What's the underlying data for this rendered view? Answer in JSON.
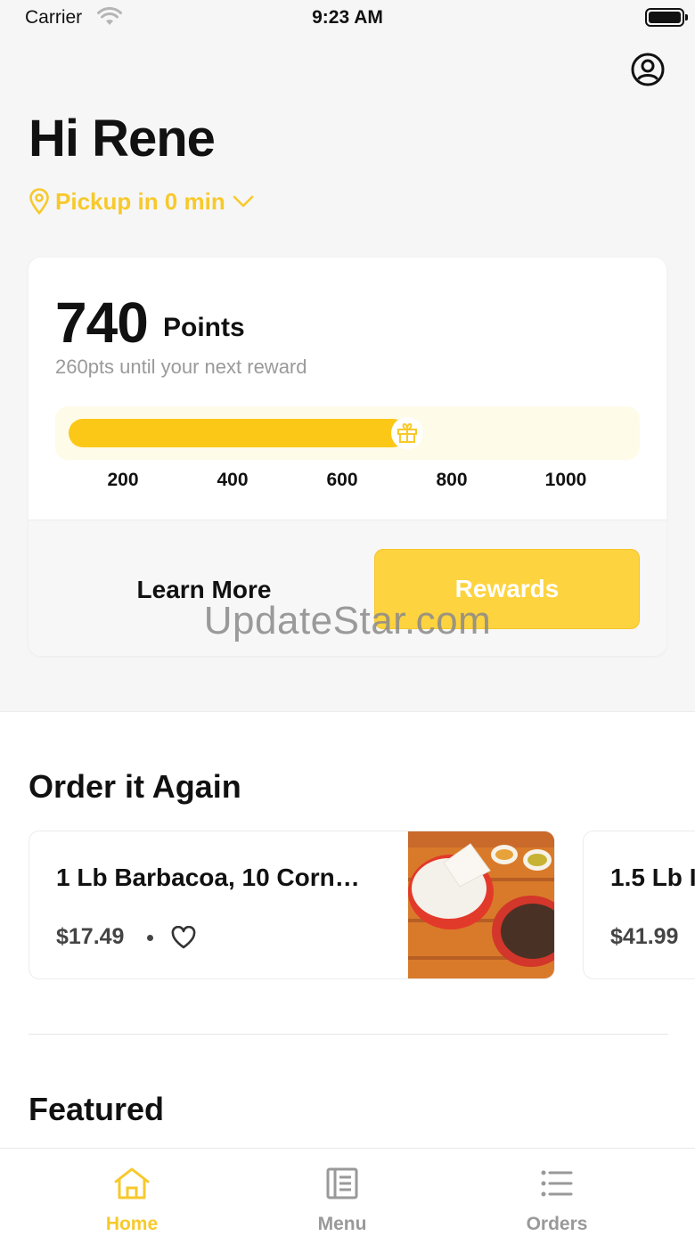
{
  "status_bar": {
    "carrier": "Carrier",
    "time": "9:23 AM"
  },
  "header": {
    "greeting": "Hi Rene",
    "pickup_text": "Pickup in 0 min"
  },
  "rewards_card": {
    "points_value": "740",
    "points_label": "Points",
    "next_reward_text": "260pts until your next reward",
    "progress": 0.74,
    "ticks": [
      "200",
      "400",
      "600",
      "800",
      "1000"
    ],
    "learn_more_label": "Learn More",
    "rewards_label": "Rewards"
  },
  "watermark": "UpdateStar.com",
  "order_again": {
    "title": "Order it Again",
    "items": [
      {
        "name": "1 Lb Barbacoa, 10 Corn…",
        "price": "$17.49"
      },
      {
        "name": "1.5 Lb I",
        "price": "$41.99"
      }
    ]
  },
  "featured": {
    "title": "Featured"
  },
  "tab_bar": {
    "tabs": [
      {
        "label": "Home",
        "icon": "home-icon",
        "active": true
      },
      {
        "label": "Menu",
        "icon": "menu-book-icon",
        "active": false
      },
      {
        "label": "Orders",
        "icon": "list-icon",
        "active": false
      }
    ]
  },
  "colors": {
    "accent": "#f7c92b",
    "progress_fill": "#fbc817",
    "rewards_button": "#fdd33f",
    "inactive_tab": "#999999"
  }
}
